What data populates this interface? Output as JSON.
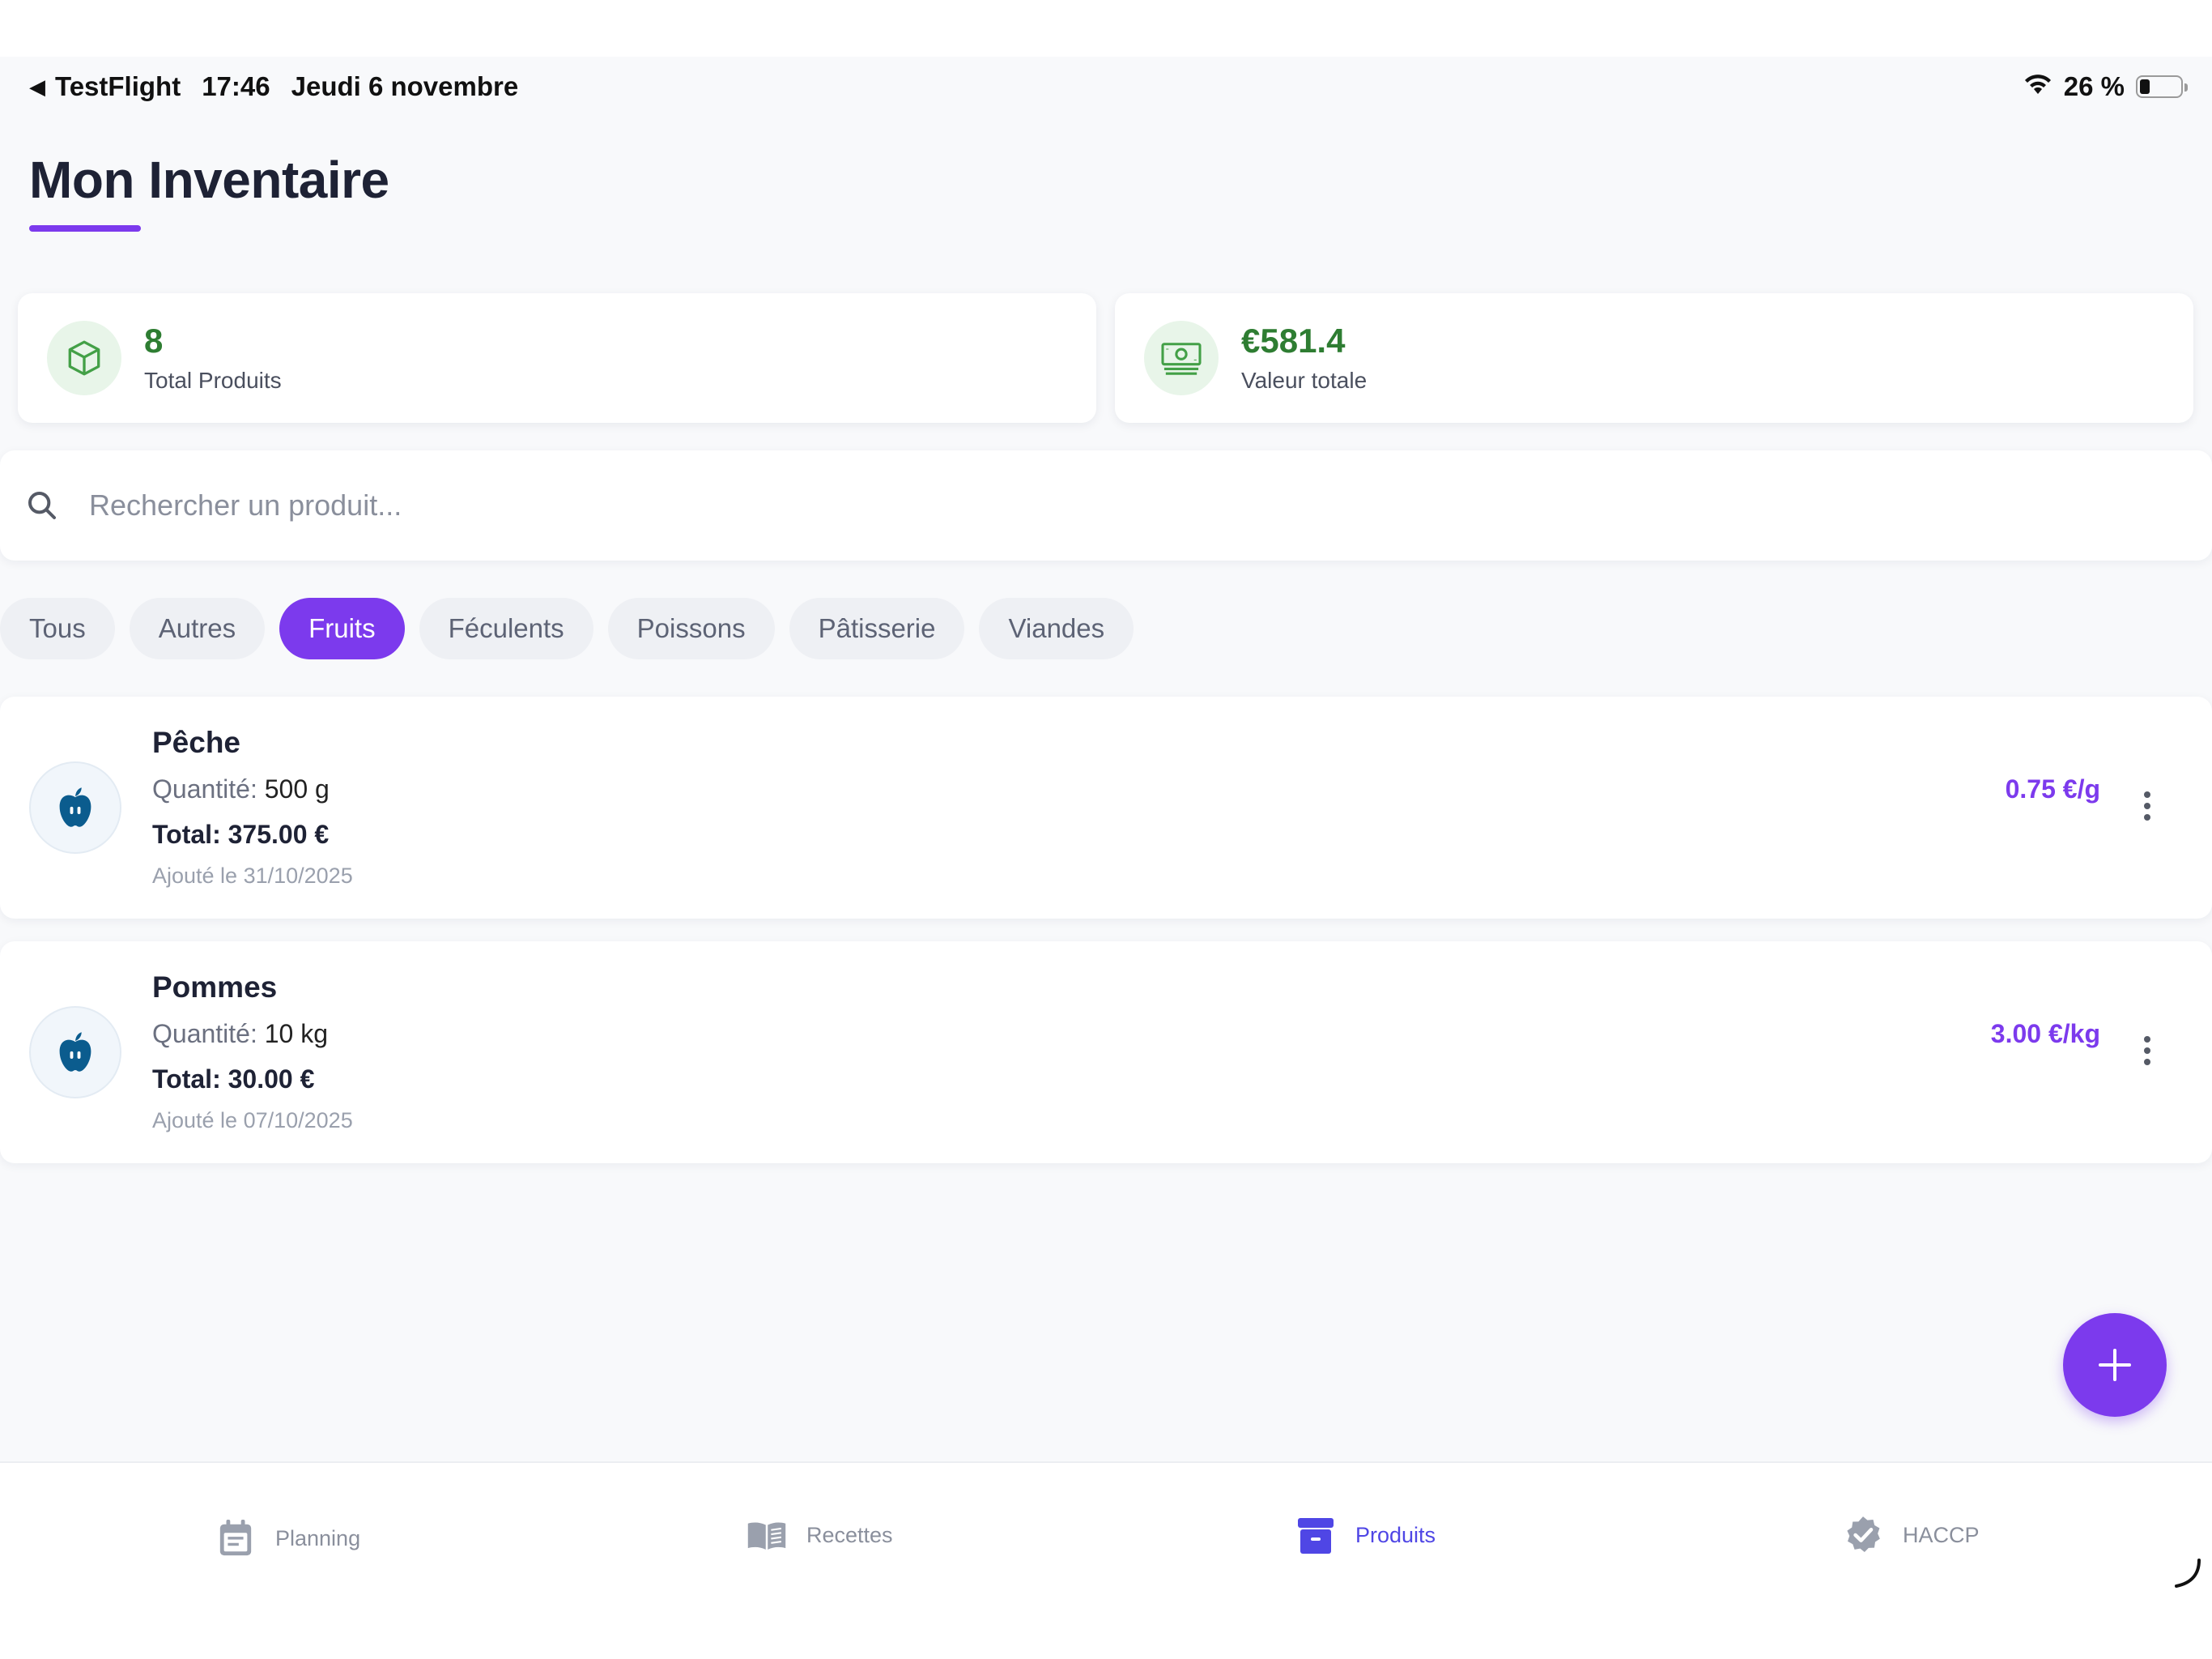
{
  "status_bar": {
    "back_app": "TestFlight",
    "time": "17:46",
    "date": "Jeudi 6 novembre",
    "battery": "26 %",
    "battery_level": 0.26
  },
  "page": {
    "title": "Mon Inventaire"
  },
  "stats": {
    "products": {
      "value": "8",
      "label": "Total Produits",
      "icon": "cube-icon"
    },
    "value": {
      "value": "€581.4",
      "label": "Valeur totale",
      "icon": "banknote-icon"
    },
    "accent": "#2e7d32"
  },
  "search": {
    "placeholder": "Rechercher un produit..."
  },
  "categories": {
    "items": [
      "Tous",
      "Autres",
      "Fruits",
      "Féculents",
      "Poissons",
      "Pâtisserie",
      "Viandes"
    ],
    "selected": "Fruits"
  },
  "products": [
    {
      "name": "Pêche",
      "quantity_label": "Quantité:",
      "quantity": "500 g",
      "total": "Total: 375.00 €",
      "added": "Ajouté le 31/10/2025",
      "unit_price": "0.75 €/g",
      "icon": "apple-icon"
    },
    {
      "name": "Pommes",
      "quantity_label": "Quantité:",
      "quantity": "10 kg",
      "total": "Total: 30.00 €",
      "added": "Ajouté le 07/10/2025",
      "unit_price": "3.00 €/kg",
      "icon": "apple-icon"
    }
  ],
  "tabs": [
    {
      "label": "Planning",
      "icon": "calendar-icon",
      "active": false
    },
    {
      "label": "Recettes",
      "icon": "book-icon",
      "active": false
    },
    {
      "label": "Produits",
      "icon": "archive-box-icon",
      "active": true
    },
    {
      "label": "HACCP",
      "icon": "verified-badge-icon",
      "active": false
    }
  ],
  "colors": {
    "primary": "#7c3aed",
    "tab_active": "#4f46e5",
    "success": "#2e7d32",
    "title": "#1e2235"
  }
}
